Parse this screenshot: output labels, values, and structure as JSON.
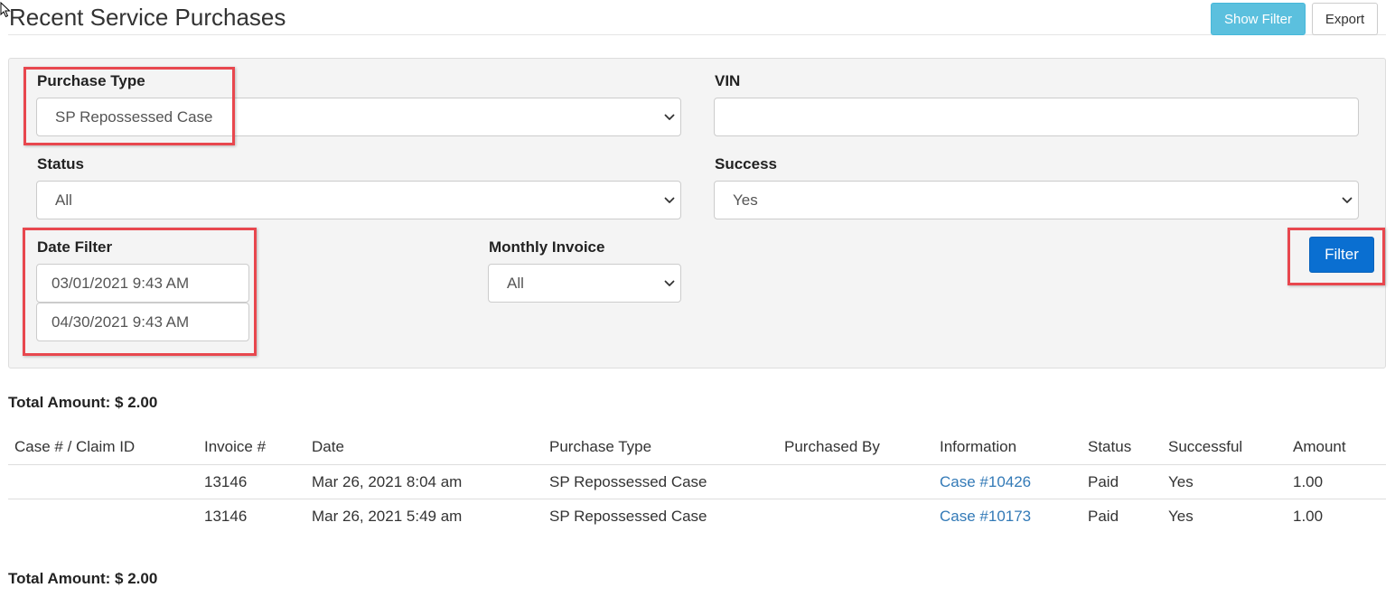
{
  "page": {
    "title": "Recent Service Purchases"
  },
  "toolbar": {
    "show_filter_label": "Show Filter",
    "export_label": "Export"
  },
  "filters": {
    "purchase_type": {
      "label": "Purchase Type",
      "value": "SP Repossessed Case"
    },
    "vin": {
      "label": "VIN",
      "value": ""
    },
    "status": {
      "label": "Status",
      "value": "All"
    },
    "success": {
      "label": "Success",
      "value": "Yes"
    },
    "date_filter": {
      "label": "Date Filter",
      "start": "03/01/2021 9:43 AM",
      "end": "04/30/2021 9:43 AM"
    },
    "monthly_invoice": {
      "label": "Monthly Invoice",
      "value": "All"
    },
    "filter_button_label": "Filter"
  },
  "totals": {
    "top": "Total Amount: $ 2.00",
    "bottom": "Total Amount: $ 2.00"
  },
  "table": {
    "columns": [
      "Case # / Claim ID",
      "Invoice #",
      "Date",
      "Purchase Type",
      "Purchased By",
      "Information",
      "Status",
      "Successful",
      "Amount"
    ],
    "rows": [
      {
        "case_claim": "",
        "invoice": "13146",
        "date": "Mar 26, 2021 8:04 am",
        "purchase_type": "SP Repossessed Case",
        "purchased_by": "",
        "information": "Case #10426",
        "status": "Paid",
        "successful": "Yes",
        "amount": "1.00"
      },
      {
        "case_claim": "",
        "invoice": "13146",
        "date": "Mar 26, 2021 5:49 am",
        "purchase_type": "SP Repossessed Case",
        "purchased_by": "",
        "information": "Case #10173",
        "status": "Paid",
        "successful": "Yes",
        "amount": "1.00"
      }
    ]
  },
  "colors": {
    "show_filter_button": "#5bc0de",
    "filter_button": "#0a6fd1",
    "highlight": "#e8474e",
    "link": "#337ab7",
    "panel_background": "#f4f4f4"
  },
  "icons": {
    "cursor": "mouse-pointer-icon",
    "dropdown": "chevron-down-icon"
  }
}
